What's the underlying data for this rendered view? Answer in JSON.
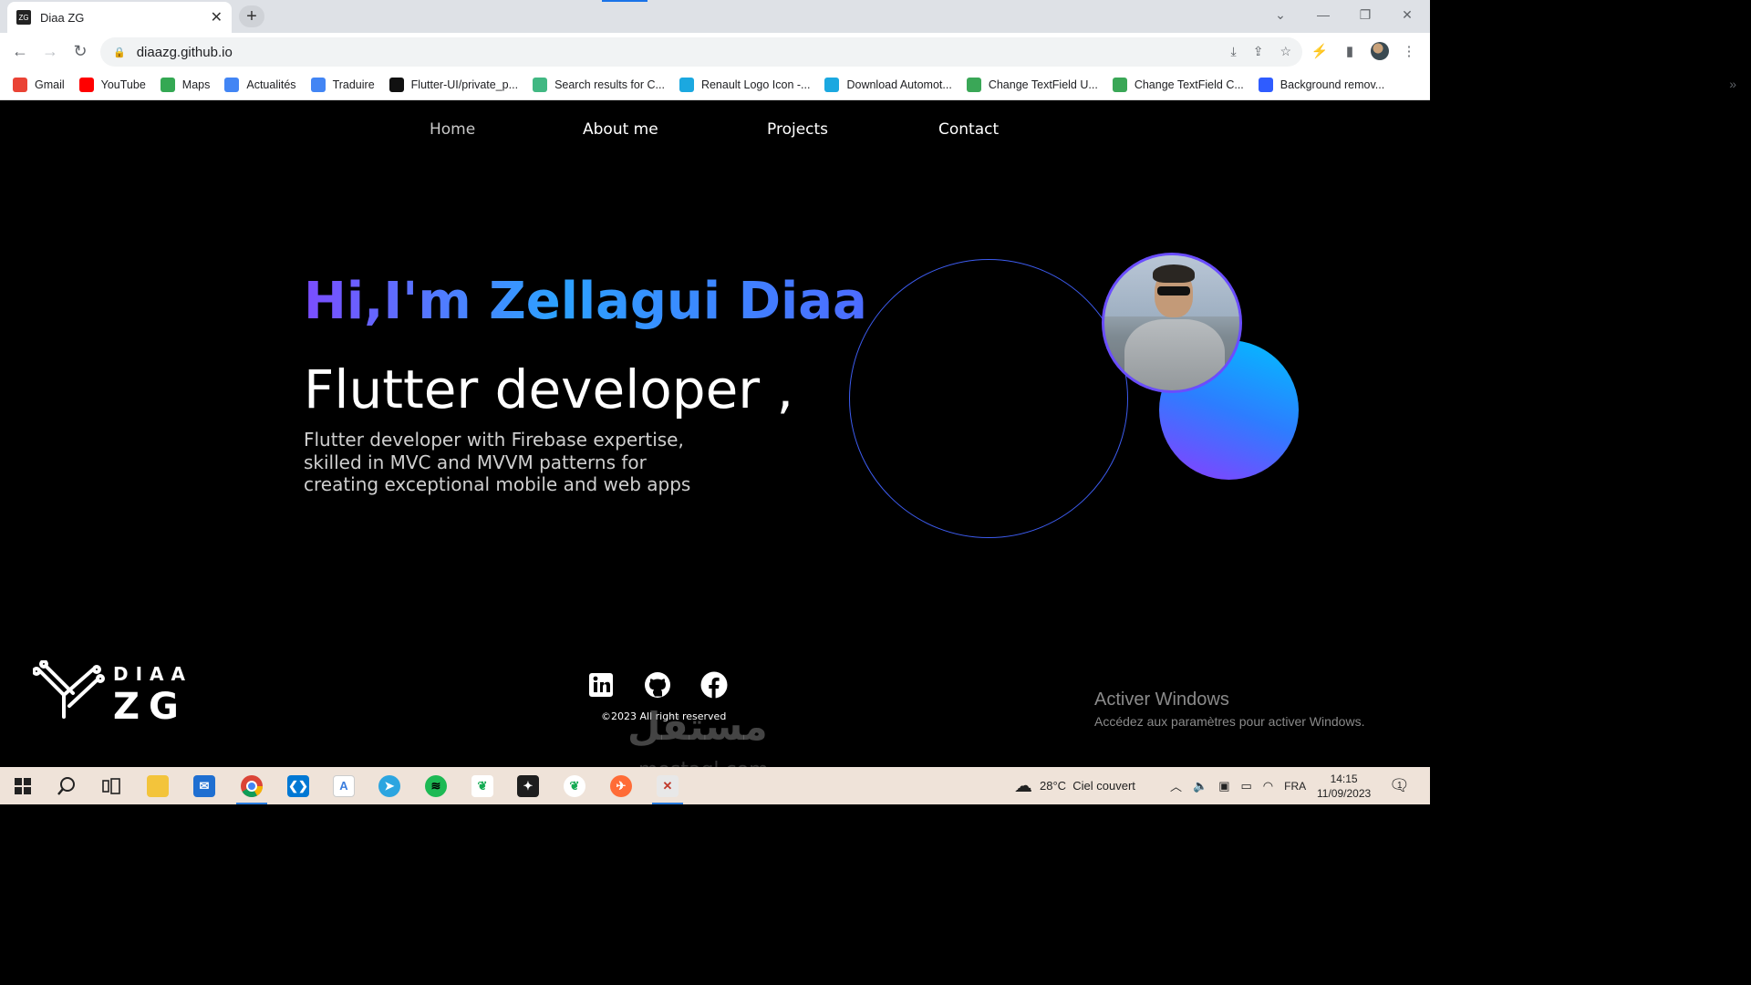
{
  "browser": {
    "tab_title": "Diaa ZG",
    "tab_favicon": "ZG",
    "url": "diaazg.github.io",
    "bookmarks": [
      {
        "label": "Gmail",
        "icon": "gmail-icon",
        "color": "#ea4335"
      },
      {
        "label": "YouTube",
        "icon": "youtube-icon",
        "color": "#ff0000"
      },
      {
        "label": "Maps",
        "icon": "maps-icon",
        "color": "#34a853"
      },
      {
        "label": "Actualités",
        "icon": "news-icon",
        "color": "#4285f4"
      },
      {
        "label": "Traduire",
        "icon": "translate-icon",
        "color": "#4285f4"
      },
      {
        "label": "Flutter-UI/private_p...",
        "icon": "github-icon",
        "color": "#111111"
      },
      {
        "label": "Search results for C...",
        "icon": "vue-icon",
        "color": "#41b883"
      },
      {
        "label": "Renault Logo Icon -...",
        "icon": "search-site-icon",
        "color": "#1ba8e0"
      },
      {
        "label": "Download Automot...",
        "icon": "search-site-icon",
        "color": "#1ba8e0"
      },
      {
        "label": "Change TextField U...",
        "icon": "f-icon",
        "color": "#3aa757"
      },
      {
        "label": "Change TextField C...",
        "icon": "f-icon",
        "color": "#3aa757"
      },
      {
        "label": "Background remov...",
        "icon": "removebg-icon",
        "color": "#2f5cff"
      }
    ]
  },
  "site": {
    "nav": [
      "Home",
      "About me",
      "Projects",
      "Contact"
    ],
    "greeting": "Hi,I'm Zellagui Diaa",
    "role": "Flutter developer ,",
    "description": "Flutter developer with Firebase expertise, skilled in MVC and MVVM patterns for creating exceptional mobile and web apps",
    "socials": [
      "linkedin-icon",
      "github-icon",
      "facebook-icon"
    ],
    "copyright": "©2023 All right reserved",
    "logo_text": [
      "DIAA",
      "ZG"
    ],
    "accent_gradient": [
      "#7b4dff",
      "#2ca2ff"
    ]
  },
  "overlay": {
    "activate_title": "Activer Windows",
    "activate_sub": "Accédez aux paramètres pour activer Windows.",
    "watermark": "مستقل",
    "watermark_sub": "mostaql.com"
  },
  "taskbar": {
    "weather_temp": "28°C",
    "weather_text": "Ciel couvert",
    "language": "FRA",
    "time": "14:15",
    "date": "11/09/2023",
    "notifications": "1",
    "apps": [
      {
        "name": "start-icon"
      },
      {
        "name": "search-icon"
      },
      {
        "name": "task-view-icon"
      },
      {
        "name": "file-explorer-icon"
      },
      {
        "name": "mail-icon"
      },
      {
        "name": "chrome-icon"
      },
      {
        "name": "vscode-icon"
      },
      {
        "name": "android-studio-icon"
      },
      {
        "name": "telegram-icon"
      },
      {
        "name": "spotify-icon"
      },
      {
        "name": "mongodb-icon"
      },
      {
        "name": "figma-icon"
      },
      {
        "name": "mongodb-compass-icon"
      },
      {
        "name": "postman-icon"
      },
      {
        "name": "git-app-icon"
      }
    ]
  }
}
